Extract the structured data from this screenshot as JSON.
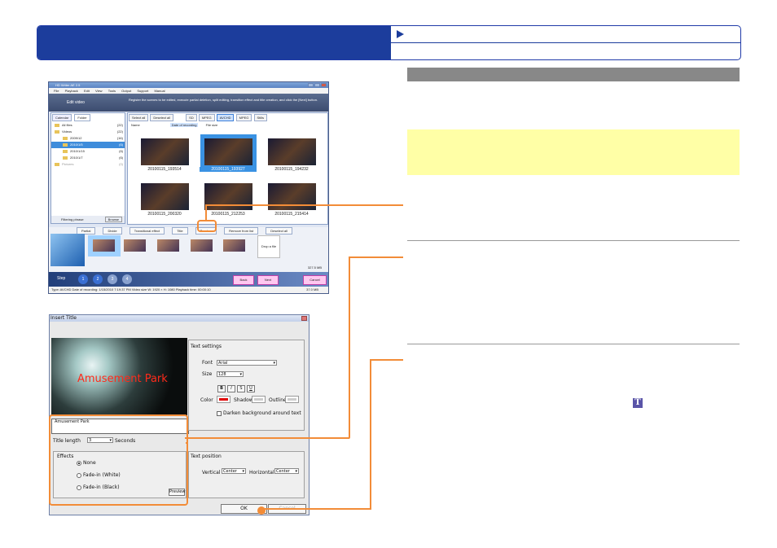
{
  "win1": {
    "title": "HD Writer AE 2.5",
    "menu": [
      "File",
      "Playback",
      "Edit",
      "View",
      "Tools",
      "Output",
      "Support",
      "Manual"
    ],
    "banner_title": "Edit video",
    "banner_desc": "Register the scenes to be edited, execute partial deletion, split editing, transition effect and title creation, and click the [Next] button.",
    "side_tabs": [
      "Calendar",
      "Folder"
    ],
    "tree": [
      {
        "label": "All files",
        "count": "(22)"
      },
      {
        "label": "Videos",
        "count": "(22)"
      },
      {
        "label": "2009/12",
        "count": "(16)"
      },
      {
        "label": "2010/1/5",
        "count": "(6)",
        "selected": true
      },
      {
        "label": "2010/1/15",
        "count": "(6)"
      },
      {
        "label": "2010/1/7",
        "count": "(6)"
      },
      {
        "label": "Pictures",
        "count": "(0)"
      }
    ],
    "side_bottom": "Filtering phrase",
    "side_bottom_btn": "Browse",
    "toolbar": [
      "Select all",
      "Deselect all"
    ],
    "formats": [
      "SD",
      "MPEG",
      "AVCHD",
      "MPEG",
      "Stills"
    ],
    "sort": [
      "Name",
      "Date of recording",
      "File size"
    ],
    "thumbs": [
      "20100115_193514",
      "20100115_193927",
      "20100115_194232",
      "20100115_200320",
      "20100115_212253",
      "20100115_215414"
    ],
    "edit_buttons": [
      "Partial",
      "Divide",
      "Transitional effect",
      "Title",
      "Preview",
      "Remove from list",
      "Deselect all"
    ],
    "drop_label": "Drop a file",
    "size_label": "327.5 MB",
    "steps_label": "Step",
    "steps": [
      "1",
      "2",
      "3",
      "4"
    ],
    "back": "Back",
    "next": "Next",
    "cancel": "Cancel",
    "status": "Type: AVCHD  Date of recording: 1/15/2010 7:19:37 PM  Video size W: 1920 × H: 1080  Playback time: 00:00:10",
    "status_right": "37.0 MB"
  },
  "dlg": {
    "title": "Insert Title",
    "preview_text": "Amusement Park",
    "title_input": "Amusement Park",
    "text_settings": "Text settings",
    "font_label": "Font",
    "font_value": "Arial",
    "size_label": "Size",
    "size_value": "128",
    "style_btns": [
      "B",
      "I",
      "S",
      "U"
    ],
    "color_label": "Color",
    "shadow_label": "Shadow",
    "outline_label": "Outline",
    "darken_label": "Darken background around text",
    "title_length_label": "Title length",
    "title_length_value": "3",
    "seconds_label": "Seconds",
    "effects_label": "Effects",
    "effects": [
      "None",
      "Fade-in (White)",
      "Fade-in (Black)"
    ],
    "preview_btn": "Preview",
    "text_position": "Text position",
    "vertical_label": "Vertical",
    "vertical_value": "Center",
    "horizontal_label": "Horizontal",
    "horizontal_value": "Center",
    "ok": "OK",
    "cancel": "Cancel"
  },
  "icons": {
    "title_tool": "T"
  },
  "colors": {
    "header_blue": "#1c3d9c",
    "callout_orange": "#f28c38",
    "note_yellow": "#ffffa6",
    "text_red": "#ff2a1a"
  }
}
